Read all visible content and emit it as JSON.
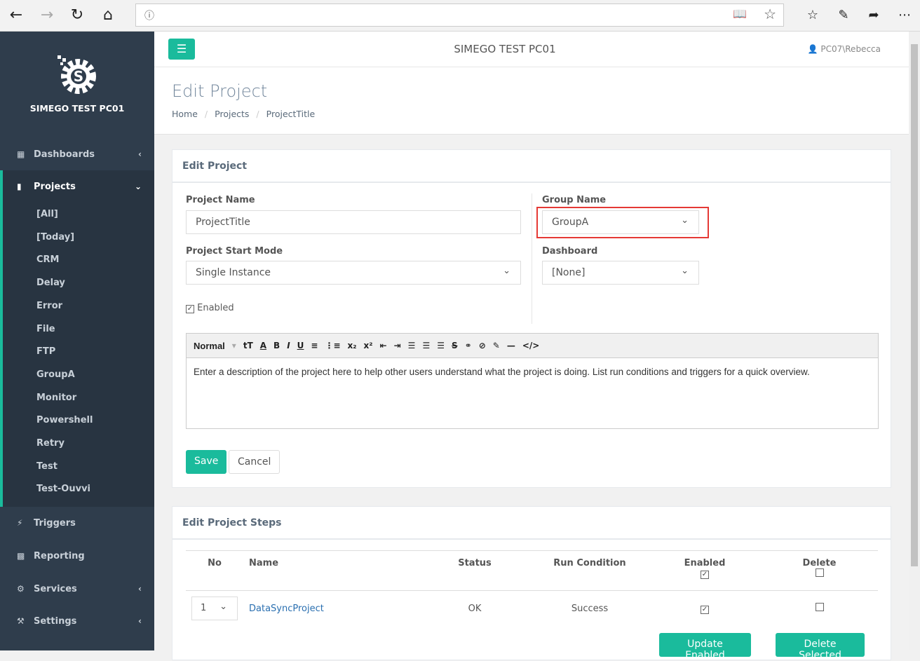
{
  "browser": {
    "icons": [
      "back-icon",
      "forward-icon",
      "refresh-icon",
      "home-icon",
      "info-icon",
      "reading-view-icon",
      "favorite-star-icon",
      "favorites-icon",
      "pen-icon",
      "share-icon",
      "more-icon"
    ]
  },
  "sidebar": {
    "brand": "SIMEGO TEST PC01",
    "items": [
      {
        "label": "Dashboards",
        "icon": "grid-icon"
      },
      {
        "label": "Projects",
        "icon": "book-icon"
      },
      {
        "label": "Triggers",
        "icon": "bolt-icon"
      },
      {
        "label": "Reporting",
        "icon": "chart-icon"
      },
      {
        "label": "Services",
        "icon": "cogs-icon"
      },
      {
        "label": "Settings",
        "icon": "wrench-icon"
      }
    ],
    "project_items": [
      "[All]",
      "[Today]",
      "CRM",
      "Delay",
      "Error",
      "File",
      "FTP",
      "GroupA",
      "Monitor",
      "Powershell",
      "Retry",
      "Test",
      "Test-Ouvvi"
    ]
  },
  "topbar": {
    "title": "SIMEGO TEST PC01",
    "user": "PC07\\Rebecca"
  },
  "page": {
    "title": "Edit Project",
    "breadcrumb": [
      "Home",
      "Projects",
      "ProjectTitle"
    ]
  },
  "form": {
    "panel_title": "Edit Project",
    "project_name_label": "Project Name",
    "project_name": "ProjectTitle",
    "group_name_label": "Group Name",
    "group_name": "GroupA",
    "start_mode_label": "Project Start Mode",
    "start_mode": "Single Instance",
    "dashboard_label": "Dashboard",
    "dashboard": "[None]",
    "enabled_label": "Enabled",
    "enabled": true,
    "editor_format": "Normal",
    "description": "Enter a description of the project here to help other users understand what the project is doing. List run conditions and triggers for a quick overview.",
    "save": "Save",
    "cancel": "Cancel",
    "highlight_color": "#e53935"
  },
  "steps": {
    "panel_title": "Edit Project Steps",
    "columns": [
      "No",
      "Name",
      "Status",
      "Run Condition",
      "Enabled",
      "Delete"
    ],
    "rows": [
      {
        "no": "1",
        "name": "DataSyncProject",
        "status": "OK",
        "run_condition": "Success",
        "enabled": true,
        "delete": false
      }
    ],
    "update_enabled": "Update Enabled",
    "delete_selected": "Delete Selected"
  },
  "colors": {
    "accent": "#1abb9c",
    "sidebar": "#2f3d4c",
    "link": "#2a6fb0"
  }
}
